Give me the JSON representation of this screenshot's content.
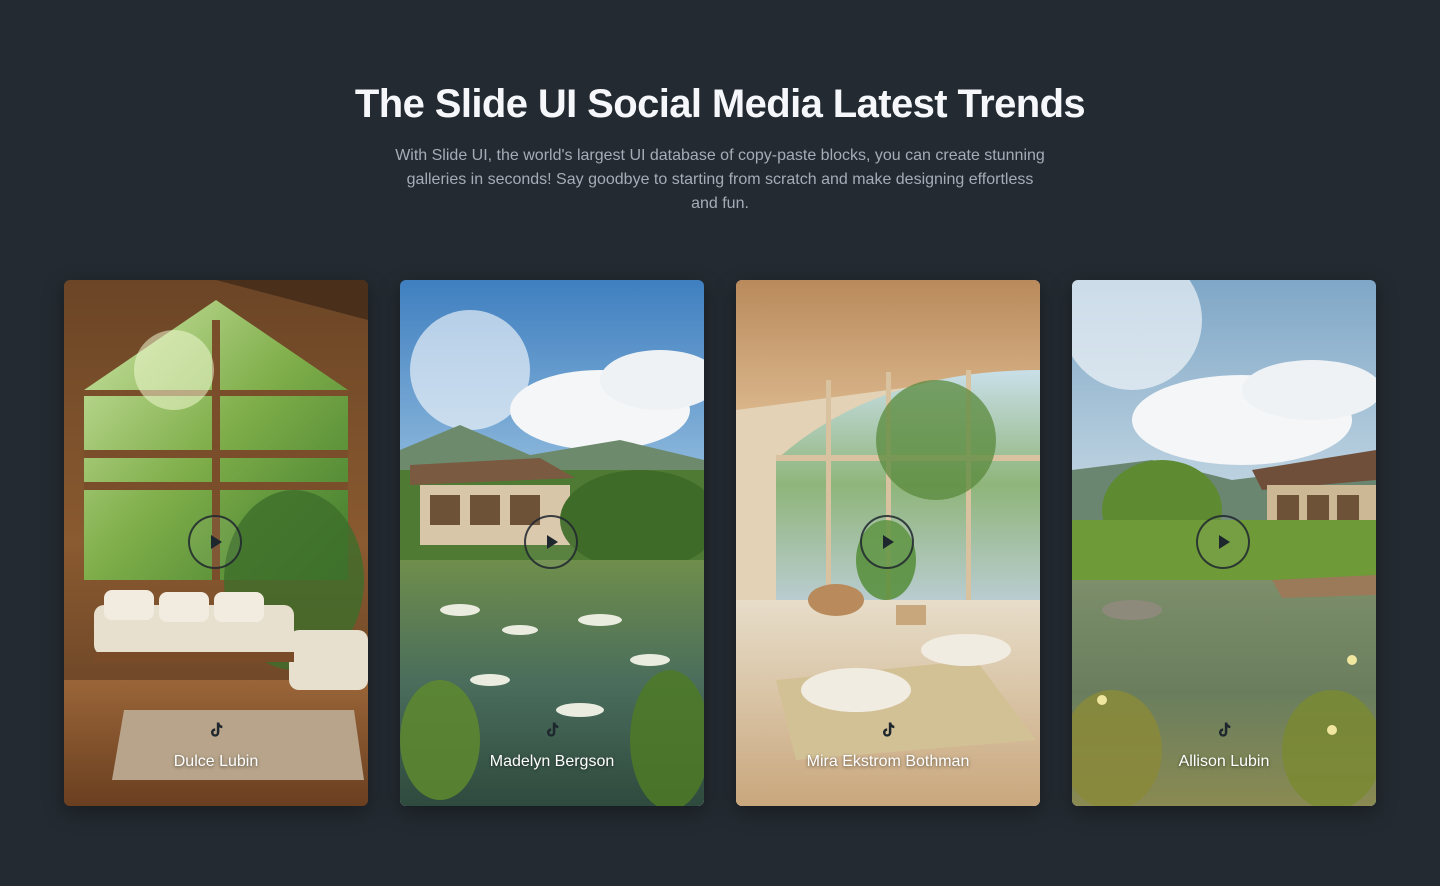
{
  "header": {
    "title": "The Slide UI Social Media Latest Trends",
    "description": "With Slide UI, the world's largest UI database of copy-paste blocks, you can create stunning galleries in seconds! Say goodbye to starting from scratch and make designing effortless and fun."
  },
  "cards": [
    {
      "name": "Dulce Lubin",
      "scene": "cabin-interior-with-sofa"
    },
    {
      "name": "Madelyn Bergson",
      "scene": "pond-with-house"
    },
    {
      "name": "Mira Ekstrom Bothman",
      "scene": "bright-room-with-cushions"
    },
    {
      "name": "Allison Lubin",
      "scene": "garden-pond-with-house"
    }
  ],
  "icons": {
    "play": "play-icon",
    "social": "tiktok-icon"
  },
  "colors": {
    "background": "#232a31",
    "title": "#f5f7fa",
    "subtitle": "#a4acb6"
  }
}
